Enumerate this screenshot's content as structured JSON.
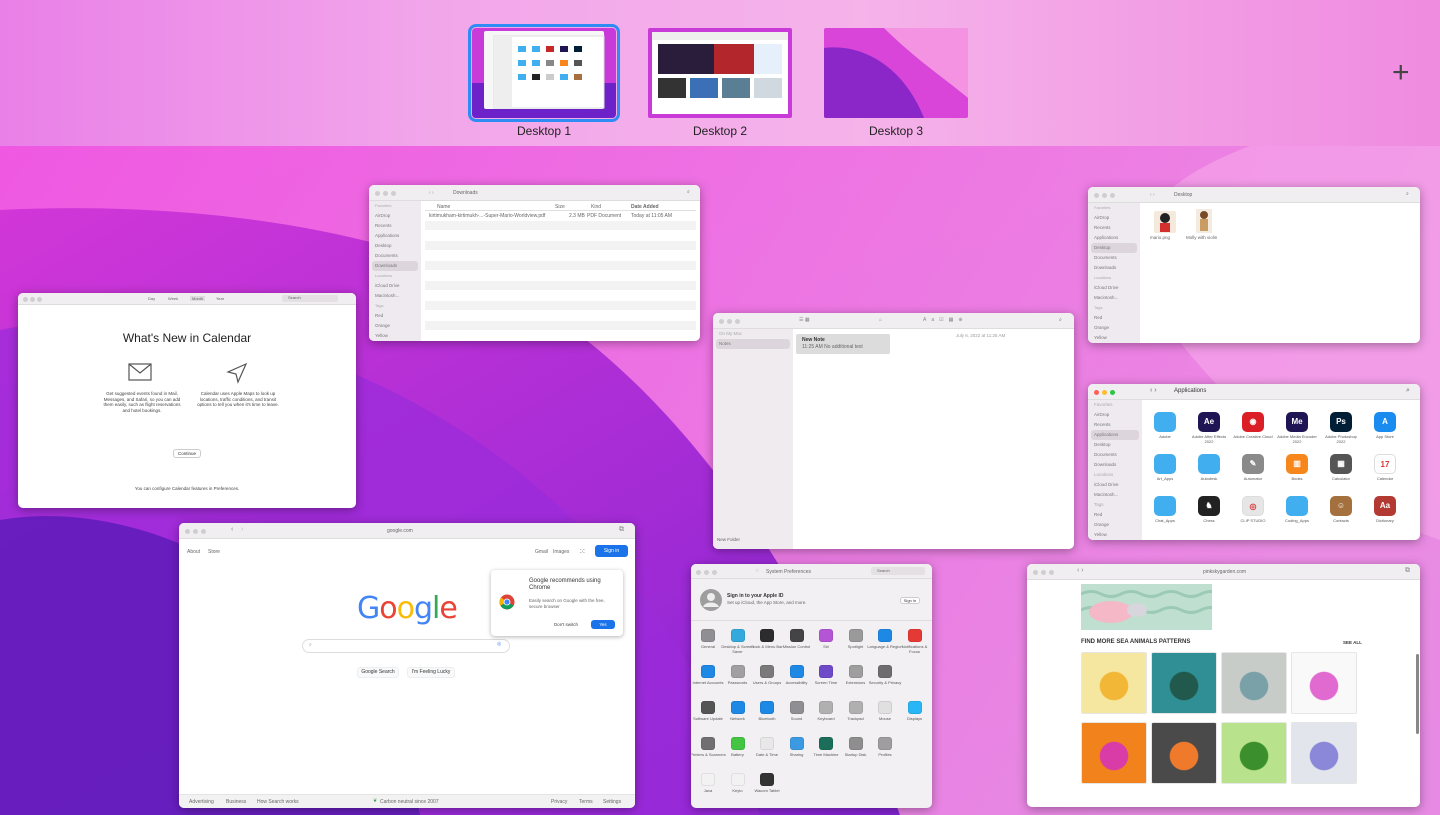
{
  "spaces_bar": {
    "desktops": [
      {
        "label": "Desktop 1",
        "selected": true
      },
      {
        "label": "Desktop 2",
        "selected": false
      },
      {
        "label": "Desktop 3",
        "selected": false
      }
    ],
    "add_symbol": "+"
  },
  "downloads_window": {
    "title": "Downloads",
    "columns": [
      "Name",
      "Size",
      "Kind",
      "Date Added"
    ],
    "file": {
      "name": "kirtimukham-kirtimukh-...-Super-Mario-Worldview.pdf",
      "size": "2.3 MB",
      "kind": "PDF Document",
      "date": "Today at 11:05 AM"
    },
    "sidebar": {
      "favorites_header": "Favorites",
      "items": [
        "AirDrop",
        "Recents",
        "Applications",
        "Desktop",
        "Documents",
        "Downloads"
      ],
      "locations_header": "Locations",
      "locations": [
        "iCloud Drive",
        "Macintosh..."
      ],
      "tags_header": "Tags",
      "tags": [
        "Red",
        "Orange",
        "Yellow"
      ]
    }
  },
  "desktop_finder": {
    "title": "Desktop",
    "sidebar": {
      "favorites_header": "Favorites",
      "items": [
        "AirDrop",
        "Recents",
        "Applications",
        "Desktop",
        "Documents",
        "Downloads"
      ],
      "locations_header": "Locations",
      "locations": [
        "iCloud Drive",
        "Macintosh..."
      ],
      "tags_header": "Tags",
      "tags": [
        "Red",
        "Orange",
        "Yellow"
      ]
    },
    "files": [
      "mario.png",
      "Molly with violin"
    ]
  },
  "calendar_window": {
    "toolbar_items": [
      "Day",
      "Week",
      "Month",
      "Year"
    ],
    "search_placeholder": "Search",
    "title": "What's New in Calendar",
    "feature1": "Get suggested events found in Mail, Messages, and Safari, so you can add them easily, such as flight reservations and hotel bookings.",
    "feature2": "Calendar uses Apple Maps to look up locations, traffic conditions, and transit options to tell you when it's time to leave.",
    "continue": "Continue",
    "footer": "You can configure Calendar features in Preferences."
  },
  "notes_window": {
    "sidebar_header": "On My Mac",
    "folder": "Notes",
    "note_title": "New Note",
    "note_preview": "11:25 AM  No additional text",
    "date_line": "July 6, 2022 at 11:25 AM",
    "new_folder": "New Folder"
  },
  "applications_window": {
    "title": "Applications",
    "sidebar": {
      "favorites_header": "Favorites",
      "items": [
        "AirDrop",
        "Recents",
        "Applications",
        "Desktop",
        "Documents",
        "Downloads"
      ],
      "locations_header": "Locations",
      "locations": [
        "iCloud Drive",
        "Macintosh..."
      ],
      "tags_header": "Tags",
      "tags": [
        "Red",
        "Orange",
        "Yellow"
      ]
    },
    "apps": [
      {
        "label": "Adobe",
        "color": "#41aef0",
        "glyph": ""
      },
      {
        "label": "Adobe After Effects 2022",
        "color": "#1f1454",
        "glyph": "Ae"
      },
      {
        "label": "Adobe Creative Cloud",
        "color": "#da1f26",
        "glyph": "◉"
      },
      {
        "label": "Adobe Media Encoder 2022",
        "color": "#1f1454",
        "glyph": "Me"
      },
      {
        "label": "Adobe Photoshop 2022",
        "color": "#001e36",
        "glyph": "Ps"
      },
      {
        "label": "App Store",
        "color": "#1a8cf0",
        "glyph": "A"
      },
      {
        "label": "Art_Apps",
        "color": "#41aef0",
        "glyph": ""
      },
      {
        "label": "Autodesk",
        "color": "#41aef0",
        "glyph": ""
      },
      {
        "label": "Automator",
        "color": "#8a8a8a",
        "glyph": "✎"
      },
      {
        "label": "Books",
        "color": "#f7861c",
        "glyph": "▥"
      },
      {
        "label": "Calculator",
        "color": "#555555",
        "glyph": "▦"
      },
      {
        "label": "Calendar",
        "color": "#ffffff",
        "glyph": "17"
      },
      {
        "label": "Chat_Apps",
        "color": "#41aef0",
        "glyph": ""
      },
      {
        "label": "Chess",
        "color": "#222222",
        "glyph": "♞"
      },
      {
        "label": "CLIP STUDIO",
        "color": "#e6e6e6",
        "glyph": "◎"
      },
      {
        "label": "Coding_Apps",
        "color": "#41aef0",
        "glyph": ""
      },
      {
        "label": "Contacts",
        "color": "#a4703e",
        "glyph": "☺"
      },
      {
        "label": "Dictionary",
        "color": "#b23a32",
        "glyph": "Aa"
      }
    ]
  },
  "chrome_window": {
    "url": "google.com",
    "links_left": [
      "About",
      "Store"
    ],
    "links_right": [
      "Gmail",
      "Images"
    ],
    "sign_in": "Sign in",
    "logo_letters": [
      {
        "ch": "G",
        "color": "#4285F4"
      },
      {
        "ch": "o",
        "color": "#EA4335"
      },
      {
        "ch": "o",
        "color": "#FBBC05"
      },
      {
        "ch": "g",
        "color": "#4285F4"
      },
      {
        "ch": "l",
        "color": "#34A853"
      },
      {
        "ch": "e",
        "color": "#EA4335"
      }
    ],
    "button_search": "Google Search",
    "button_lucky": "I'm Feeling Lucky",
    "popup_title": "Google recommends using Chrome",
    "popup_body": "Easily search on Google with the free, secure browser",
    "popup_dismiss": "Don't switch",
    "popup_yes": "Yes",
    "footer_left": [
      "Advertising",
      "Business",
      "How Search works"
    ],
    "footer_center": "Carbon neutral since 2007",
    "footer_right": [
      "Privacy",
      "Terms",
      "Settings"
    ]
  },
  "sysprefs_window": {
    "title": "System Preferences",
    "search_placeholder": "Search",
    "account_title": "Sign in to your Apple ID",
    "account_sub": "Set up iCloud, the App Store, and more.",
    "sign_in": "Sign In",
    "prefs": [
      {
        "label": "General",
        "color": "#8e8e93"
      },
      {
        "label": "Desktop & Screen Saver",
        "color": "#34aadc"
      },
      {
        "label": "Dock & Menu Bar",
        "color": "#2c2c2e"
      },
      {
        "label": "Mission Control",
        "color": "#444446"
      },
      {
        "label": "Siri",
        "color": "#b455d6"
      },
      {
        "label": "Spotlight",
        "color": "#9a9a9a"
      },
      {
        "label": "Language & Region",
        "color": "#1e88e5"
      },
      {
        "label": "Notifications & Focus",
        "color": "#e53935"
      },
      {
        "label": "Internet Accounts",
        "color": "#1e88e5"
      },
      {
        "label": "Passwords",
        "color": "#a0a0a0"
      },
      {
        "label": "Users & Groups",
        "color": "#7a7a7a"
      },
      {
        "label": "Accessibility",
        "color": "#1e88e5"
      },
      {
        "label": "Screen Time",
        "color": "#6e49c8"
      },
      {
        "label": "Extensions",
        "color": "#9e9e9e"
      },
      {
        "label": "Security & Privacy",
        "color": "#6d6d6d"
      },
      {
        "label": "",
        "color": ""
      },
      {
        "label": "Software Update",
        "color": "#555555"
      },
      {
        "label": "Network",
        "color": "#1e88e5"
      },
      {
        "label": "Bluetooth",
        "color": "#1e88e5"
      },
      {
        "label": "Sound",
        "color": "#8e8e93"
      },
      {
        "label": "Keyboard",
        "color": "#b0b0b0"
      },
      {
        "label": "Trackpad",
        "color": "#b0b0b0"
      },
      {
        "label": "Mouse",
        "color": "#e0e0e0"
      },
      {
        "label": "Displays",
        "color": "#29b6f6"
      },
      {
        "label": "Printers & Scanners",
        "color": "#707070"
      },
      {
        "label": "Battery",
        "color": "#43c443"
      },
      {
        "label": "Date & Time",
        "color": "#e8e8e8"
      },
      {
        "label": "Sharing",
        "color": "#3b9ae1"
      },
      {
        "label": "Time Machine",
        "color": "#1b6e5a"
      },
      {
        "label": "Startup Disk",
        "color": "#8e8e8e"
      },
      {
        "label": "Profiles",
        "color": "#9e9e9e"
      },
      {
        "label": "",
        "color": ""
      },
      {
        "label": "Java",
        "color": "#f2f2f2"
      },
      {
        "label": "Keyto",
        "color": "#f2f2f2"
      },
      {
        "label": "Wacom Tablet",
        "color": "#333333"
      }
    ]
  },
  "safari_window": {
    "url": "pinkskygarden.com",
    "section_title": "FIND MORE SEA ANIMALS PATTERNS",
    "see_all": "SEE ALL",
    "thumbs": [
      {
        "colors": [
          "#f6e7a0",
          "#f2b736"
        ]
      },
      {
        "colors": [
          "#2f8f94",
          "#215a4d"
        ]
      },
      {
        "colors": [
          "#c7ccc9",
          "#7aa0a8"
        ]
      },
      {
        "colors": [
          "#f9f9f9",
          "#e06ad0"
        ]
      },
      {
        "colors": [
          "#f2831c",
          "#d93ca6"
        ]
      },
      {
        "colors": [
          "#4a4a4a",
          "#f07a2c"
        ]
      },
      {
        "colors": [
          "#b9e28c",
          "#3b8f2d"
        ]
      },
      {
        "colors": [
          "#e2e6ec",
          "#8b87d9"
        ]
      }
    ]
  }
}
